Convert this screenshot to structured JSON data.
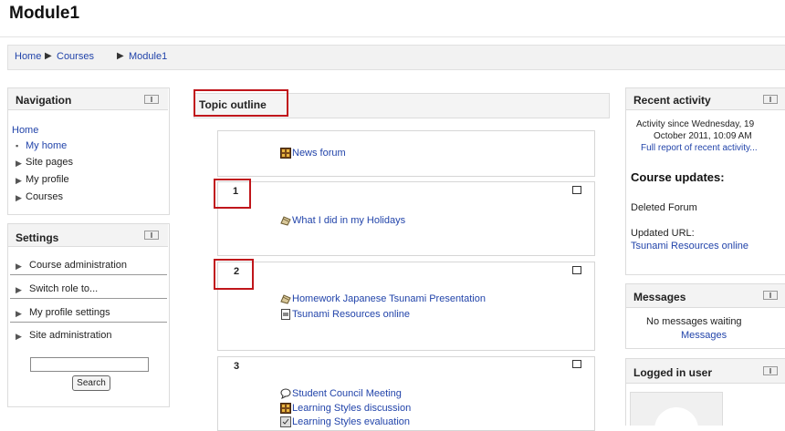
{
  "page": {
    "title": "Module1"
  },
  "breadcrumb": {
    "home": "Home",
    "courses": "Courses",
    "current": "Module1",
    "separator": "▶"
  },
  "navigation": {
    "title": "Navigation",
    "home": "Home",
    "items": [
      "My home",
      "Site pages",
      "My profile",
      "Courses"
    ]
  },
  "settings": {
    "title": "Settings",
    "items": [
      "Course administration",
      "Switch role to...",
      "My profile settings",
      "Site administration"
    ],
    "search_button": "Search",
    "search_value": ""
  },
  "main": {
    "topic_outline": "Topic outline",
    "sections": [
      {
        "number": "",
        "items": [
          "News forum"
        ]
      },
      {
        "number": "1",
        "items": [
          "What I did in my Holidays"
        ]
      },
      {
        "number": "2",
        "items": [
          "Homework Japanese Tsunami Presentation",
          "Tsunami Resources online"
        ]
      },
      {
        "number": "3",
        "items": [
          "Student Council Meeting",
          "Learning Styles discussion",
          "Learning Styles evaluation"
        ]
      }
    ]
  },
  "recent_activity": {
    "title": "Recent activity",
    "since_line1": "Activity since Wednesday, 19",
    "since_line2": "October 2011, 10:09 AM",
    "full_report": "Full report of recent activity...",
    "course_updates": "Course updates:",
    "deleted": "Deleted Forum",
    "updated_label": "Updated URL:",
    "updated_link": "Tsunami Resources online"
  },
  "messages": {
    "title": "Messages",
    "none": "No messages waiting",
    "link": "Messages"
  },
  "logged_in": {
    "title": "Logged in user"
  },
  "icons": {
    "forum": "forum-icon",
    "assignment": "assignment-icon",
    "url": "url-icon",
    "chat": "chat-icon",
    "feedback": "feedback-icon",
    "dock": "dock-icon",
    "edit_checkbox": "edit-checkbox-icon",
    "avatar": "avatar-icon"
  },
  "colors": {
    "link": "#2244aa",
    "highlight": "#c0161b",
    "header_bg": "#f3f3f3",
    "border": "#dcdcdc"
  }
}
